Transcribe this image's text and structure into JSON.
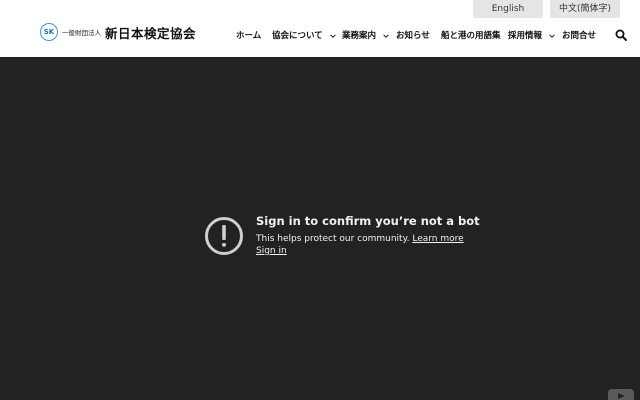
{
  "language_bar": {
    "english": "English",
    "chinese": "中文(簡体字)"
  },
  "logo": {
    "mark": "SK",
    "subtitle": "一般財団法人",
    "name": "新日本検定協会"
  },
  "nav": {
    "items": [
      {
        "label": "ホーム",
        "has_dropdown": false
      },
      {
        "label": "協会について",
        "has_dropdown": true
      },
      {
        "label": "業務案内",
        "has_dropdown": true
      },
      {
        "label": "お知らせ",
        "has_dropdown": false
      },
      {
        "label": "船と港の用語集",
        "has_dropdown": false
      },
      {
        "label": "採用情報",
        "has_dropdown": true
      },
      {
        "label": "お問合せ",
        "has_dropdown": false
      }
    ],
    "search_icon": "search-icon"
  },
  "video": {
    "title": "Sign in to confirm you’re not a bot",
    "body": "This helps protect our community.",
    "learn_more": "Learn more",
    "sign_in": "Sign in",
    "alert_icon": "alert-circle-icon",
    "logo_icon": "youtube-icon"
  },
  "colors": {
    "video_background": "#222222",
    "language_button_bg": "#e5e5e5",
    "logo_accent": "#3a9ad9"
  }
}
